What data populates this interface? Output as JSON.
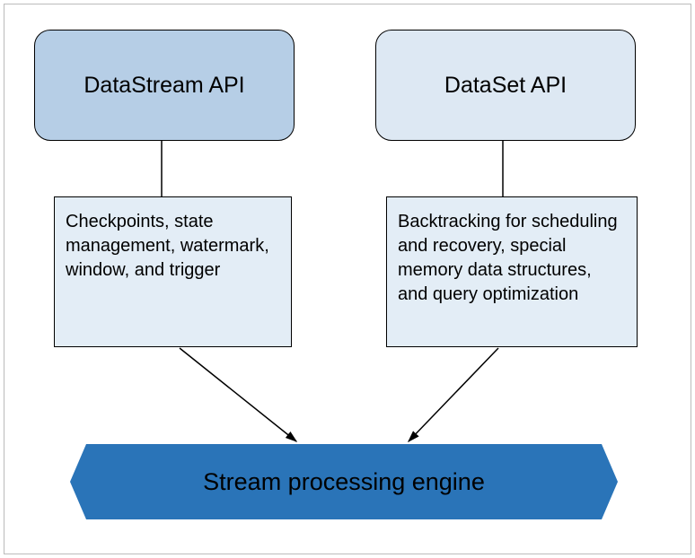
{
  "nodes": {
    "datastream_api": "DataStream API",
    "dataset_api": "DataSet API",
    "datastream_desc": "Checkpoints, state management, watermark, window, and trigger",
    "dataset_desc": "Backtracking for scheduling and recovery, special memory data structures, and query optimization",
    "engine": "Stream processing engine"
  }
}
